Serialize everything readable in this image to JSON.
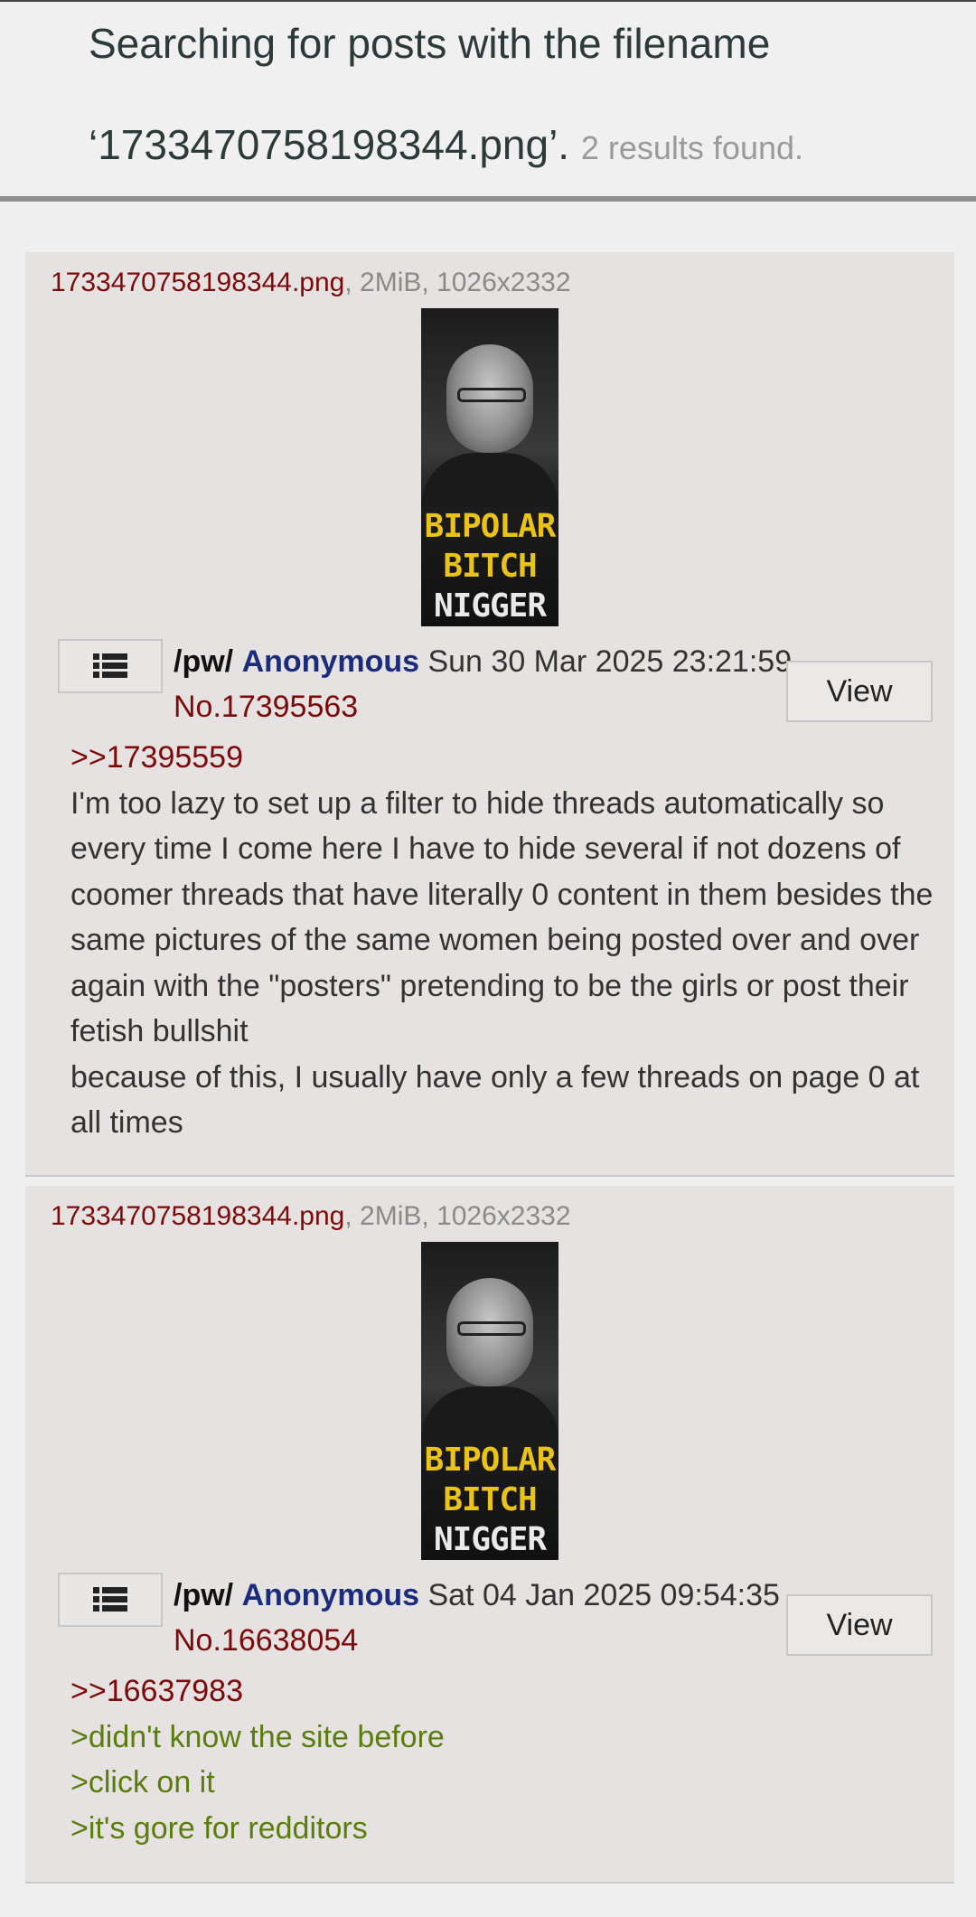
{
  "header": {
    "line1": "Searching for posts with the filename",
    "line2": "‘1733470758198344.png’.",
    "count": "2 results found."
  },
  "image_caption": [
    "BIPOLAR",
    "BITCH",
    "NIGGER"
  ],
  "posts": [
    {
      "filename": "1733470758198344.png",
      "fileinfo": ", 2MiB, 1026x2332",
      "board": "/pw/",
      "name": "Anonymous",
      "date": "Sun 30 Mar 2025 23:21:59",
      "number": "No.17395563",
      "view_label": "View",
      "quote": ">>17395559",
      "lines": [
        "I'm too lazy to set up a filter to hide threads automatically so every time I come here I have to hide several if not dozens of coomer threads that have literally 0 content in them besides the same pictures of the same women being posted over and over again with the \"posters\" pretending to be the girls or post their fetish bullshit",
        "because of this, I usually have only a few threads on page 0 at all times"
      ]
    },
    {
      "filename": "1733470758198344.png",
      "fileinfo": ", 2MiB, 1026x2332",
      "board": "/pw/",
      "name": "Anonymous",
      "date": "Sat 04 Jan 2025 09:54:35",
      "number": "No.16638054",
      "view_label": "View",
      "quote": ">>16637983",
      "greentext": [
        ">didn't know the site before",
        ">click on it",
        ">it's gore for redditors"
      ]
    }
  ],
  "colors": {
    "quote": "#7c0a0a",
    "name": "#1b2c7a",
    "greentext": "#5a7d0d",
    "post_bg": "#e5e2e1"
  }
}
